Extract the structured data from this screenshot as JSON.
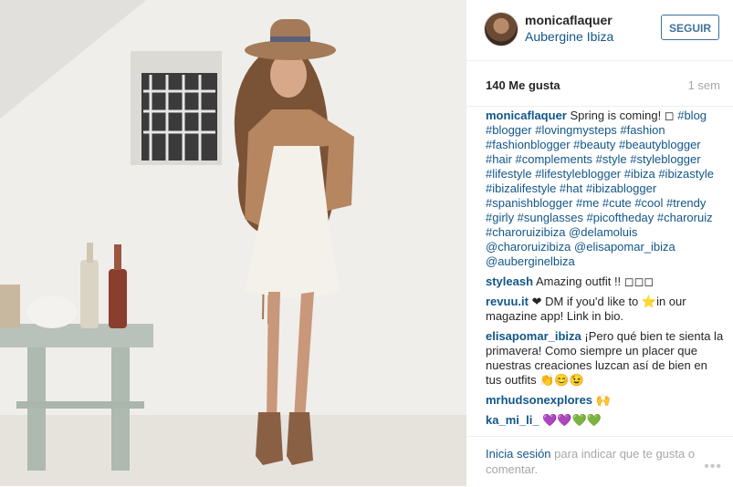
{
  "post": {
    "username": "monicaflaquer",
    "location": "Aubergine Ibiza",
    "follow_label": "SEGUIR",
    "likes": "140 Me gusta",
    "time": "1 sem",
    "caption_user": "monicaflaquer",
    "caption_text": "Spring is coming! ◻ ",
    "caption_tags": "#blog #blogger #lovingmysteps #fashion #fashionblogger #beauty #beautyblogger #hair #complements #style #styleblogger #lifestyle #lifestyleblogger #ibiza #ibizastyle #ibizalifestyle #hat #ibizablogger #spanishblogger #me #cute #cool #trendy #girly #sunglasses #picoftheday #charoruiz #charoruizibiza @delamoluis @charoruizibiza @elisapomar_ibiza @auberginelbiza"
  },
  "comments": [
    {
      "user": "styleash",
      "text": "Amazing outfit !! ◻◻◻"
    },
    {
      "user": "revuu.it",
      "text": "❤ DM if you'd like to ⭐in our magazine app! Link in bio."
    },
    {
      "user": "elisapomar_ibiza",
      "text": "¡Pero qué bien te sienta la primavera! Como siempre un placer que nuestras creaciones luzcan así de bien en tus outfits 👏😊😉"
    },
    {
      "user": "mrhudsonexplores",
      "text": "🙌"
    },
    {
      "user": "ka_mi_li_",
      "text": "💜💜💚💚"
    }
  ],
  "footer": {
    "login_link": "Inicia sesión",
    "login_text": " para indicar que te gusta o comentar.",
    "more_icon": "•••"
  }
}
